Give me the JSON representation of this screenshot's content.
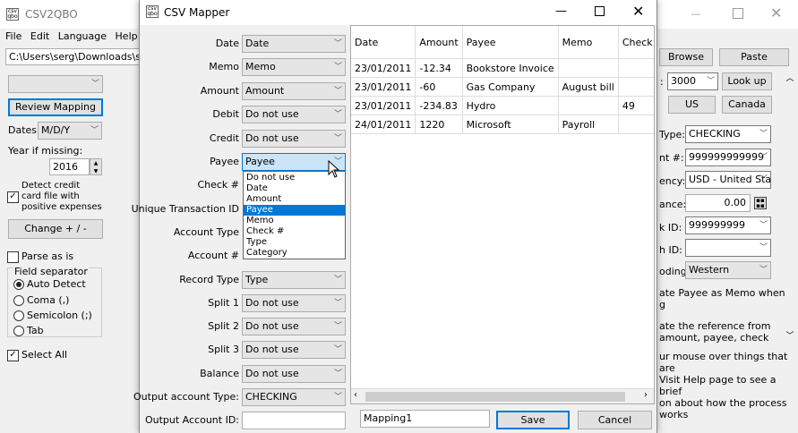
{
  "bg_window": {
    "title": "CSV2QBO",
    "menu": [
      "File",
      "Edit",
      "Language",
      "Help"
    ],
    "path_value": "C:\\Users\\serg\\Downloads\\sampl",
    "review_mapping": "Review Mapping",
    "dates_label": "Dates:",
    "dates_value": "M/D/Y",
    "year_label": "Year if missing:",
    "year_value": "2016",
    "detect_credit_label": "Detect credit card file with positive expenses",
    "change_btn": "Change + / -",
    "parse_as_is": "Parse as is",
    "field_separator": "Field separator",
    "sep_options": [
      "Auto Detect",
      "Coma (,)",
      "Semicolon (;)",
      "Tab"
    ],
    "select_all": "Select All"
  },
  "right_panel": {
    "browse": "Browse",
    "paste": "Paste",
    "rows_value": "3000",
    "rows_prefix": ":",
    "lookup": "Look up",
    "us": "US",
    "canada": "Canada",
    "type_label": "Type:",
    "type_value": "CHECKING",
    "acct_label": "nt #:",
    "acct_value": "999999999999",
    "currency_label": "ency:",
    "currency_value": "USD - United Sta",
    "balance_label": "ance:",
    "balance_value": "0.00",
    "bank_label": "k ID:",
    "bank_value": "999999999",
    "branch_label": "h ID:",
    "branch_value": "",
    "encoding_label": "oding:",
    "encoding_value": "Western",
    "opt1": "ate Payee as Memo when",
    "opt1b": "g",
    "opt2": "ate the reference from",
    "opt2b": "amount, payee, check",
    "help1": "ur mouse over things that are",
    "help2": "Visit Help page to see a brief",
    "help3": "on about how the process works"
  },
  "mapper": {
    "title": "CSV Mapper",
    "fields": [
      {
        "label": "Date",
        "value": "Date"
      },
      {
        "label": "Memo",
        "value": "Memo"
      },
      {
        "label": "Amount",
        "value": "Amount"
      },
      {
        "label": "Debit",
        "value": "Do not use"
      },
      {
        "label": "Credit",
        "value": "Do not use"
      },
      {
        "label": "Payee",
        "value": "Payee"
      },
      {
        "label": "Check #",
        "value": ""
      },
      {
        "label": "Unique Transaction ID",
        "value": ""
      },
      {
        "label": "Account Type",
        "value": ""
      },
      {
        "label": "Account #",
        "value": ""
      },
      {
        "label": "Record Type",
        "value": "Type"
      },
      {
        "label": "Split 1",
        "value": "Do not use"
      },
      {
        "label": "Split 2",
        "value": "Do not use"
      },
      {
        "label": "Split 3",
        "value": "Do not use"
      },
      {
        "label": "Balance",
        "value": "Do not use"
      },
      {
        "label": "Output account Type:",
        "value": "CHECKING"
      }
    ],
    "output_account_id_label": "Output Account ID:",
    "output_account_id_value": "",
    "dropdown_options": [
      "Do not use",
      "Date",
      "Amount",
      "Payee",
      "Memo",
      "Check #",
      "Type",
      "Category"
    ],
    "dropdown_selected": "Payee",
    "grid_headers": [
      "Date",
      "Amount",
      "Payee",
      "Memo",
      "Check #"
    ],
    "grid_rows": [
      [
        "23/01/2011",
        "-12.34",
        "Bookstore Invoice",
        "",
        ""
      ],
      [
        "23/01/2011",
        "-60",
        "Gas Company",
        "August bill",
        ""
      ],
      [
        "23/01/2011",
        "-234.83",
        "Hydro",
        "",
        "49"
      ],
      [
        "24/01/2011",
        "1220",
        "Microsoft",
        "Payroll",
        ""
      ]
    ],
    "mapping_name": "Mapping1",
    "save": "Save",
    "cancel": "Cancel"
  }
}
